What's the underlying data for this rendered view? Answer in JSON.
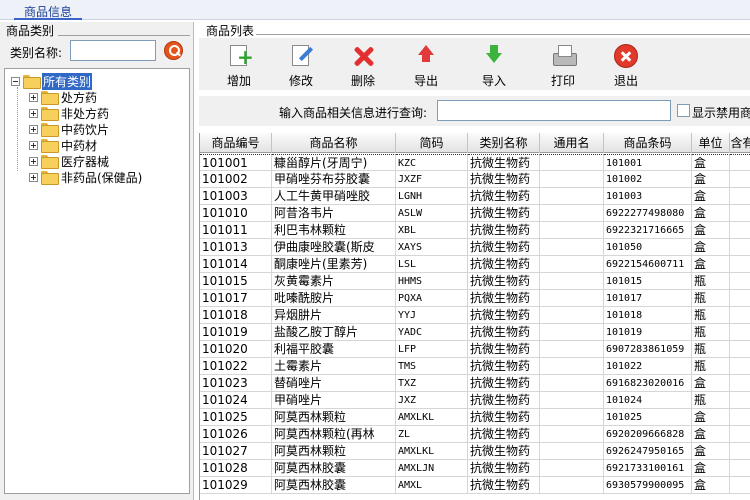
{
  "tab_title": "商品信息",
  "left": {
    "panel_title": "商品类别",
    "category_label": "类别名称:",
    "tree": {
      "root": "所有类别",
      "children": [
        "处方药",
        "非处方药",
        "中药饮片",
        "中药材",
        "医疗器械",
        "非药品(保健品)"
      ]
    }
  },
  "right": {
    "panel_title": "商品列表",
    "toolbar": [
      {
        "label": "增加",
        "icon": "add-document-icon"
      },
      {
        "label": "修改",
        "icon": "edit-document-icon"
      },
      {
        "label": "删除",
        "icon": "delete-x-icon"
      },
      {
        "label": "导出",
        "icon": "arrow-up-icon"
      },
      {
        "label": "导入",
        "icon": "arrow-down-icon"
      },
      {
        "label": "打印",
        "icon": "printer-icon"
      },
      {
        "label": "退出",
        "icon": "exit-icon"
      }
    ],
    "search_label": "输入商品相关信息进行查询:",
    "search_value": "",
    "checkbox_label": "显示禁用商"
  },
  "grid": {
    "columns": [
      "商品编号",
      "商品名称",
      "简码",
      "类别名称",
      "通用名",
      "商品条码",
      "单位",
      "含有麻黄"
    ],
    "rows": [
      [
        "101001",
        "糠甾醇片(牙周宁)",
        "KZC",
        "抗微生物药",
        "",
        "101001",
        "盒"
      ],
      [
        "101002",
        "甲硝唑芬布芬胶囊",
        "JXZF",
        "抗微生物药",
        "",
        "101002",
        "盒"
      ],
      [
        "101003",
        "人工牛黄甲硝唑胶",
        "LGNH",
        "抗微生物药",
        "",
        "101003",
        "盒"
      ],
      [
        "101010",
        "阿昔洛韦片",
        "ASLW",
        "抗微生物药",
        "",
        "6922277498080",
        "盒"
      ],
      [
        "101011",
        "利巴韦林颗粒",
        "XBL",
        "抗微生物药",
        "",
        "6922321716665",
        "盒"
      ],
      [
        "101013",
        "伊曲康唑胶囊(斯皮",
        "XAYS",
        "抗微生物药",
        "",
        "101050",
        "盒"
      ],
      [
        "101014",
        "酮康唑片(里素芳)",
        "LSL",
        "抗微生物药",
        "",
        "6922154600711",
        "盒"
      ],
      [
        "101015",
        "灰黄霉素片",
        "HHMS",
        "抗微生物药",
        "",
        "101015",
        "瓶"
      ],
      [
        "101017",
        "吡嗪酰胺片",
        "PQXA",
        "抗微生物药",
        "",
        "101017",
        "瓶"
      ],
      [
        "101018",
        "异烟肼片",
        "YYJ",
        "抗微生物药",
        "",
        "101018",
        "瓶"
      ],
      [
        "101019",
        "盐酸乙胺丁醇片",
        "YADC",
        "抗微生物药",
        "",
        "101019",
        "瓶"
      ],
      [
        "101020",
        "利福平胶囊",
        "LFP",
        "抗微生物药",
        "",
        "6907283861059",
        "瓶"
      ],
      [
        "101022",
        "土霉素片",
        "TMS",
        "抗微生物药",
        "",
        "101022",
        "瓶"
      ],
      [
        "101023",
        "替硝唑片",
        "TXZ",
        "抗微生物药",
        "",
        "6916823020016",
        "盒"
      ],
      [
        "101024",
        "甲硝唑片",
        "JXZ",
        "抗微生物药",
        "",
        "101024",
        "瓶"
      ],
      [
        "101025",
        "阿莫西林颗粒",
        "AMXLKL",
        "抗微生物药",
        "",
        "101025",
        "盒"
      ],
      [
        "101026",
        "阿莫西林颗粒(再林",
        "ZL",
        "抗微生物药",
        "",
        "6920209666828",
        "盒"
      ],
      [
        "101027",
        "阿莫西林颗粒",
        "AMXLKL",
        "抗微生物药",
        "",
        "6926247950165",
        "盒"
      ],
      [
        "101028",
        "阿莫西林胶囊",
        "AMXLJN",
        "抗微生物药",
        "",
        "6921733100161",
        "盒"
      ],
      [
        "101029",
        "阿莫西林胶囊",
        "AMXL",
        "抗微生物药",
        "",
        "6930579900095",
        "盒"
      ]
    ]
  }
}
